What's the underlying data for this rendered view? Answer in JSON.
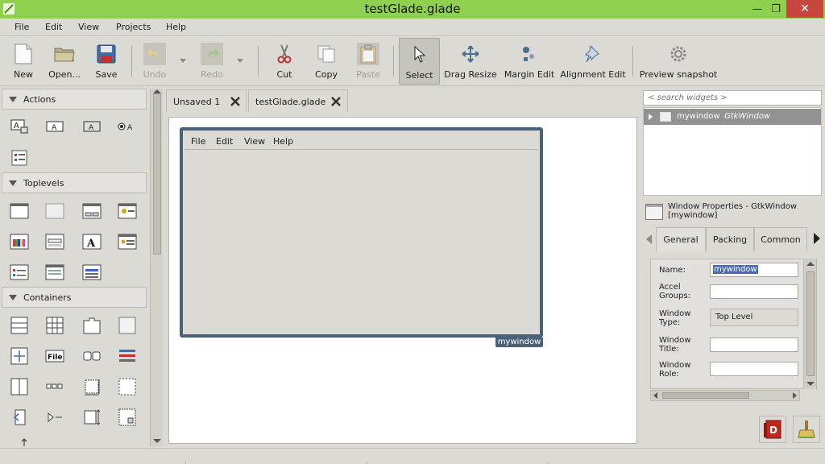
{
  "window": {
    "title": "testGlade.glade",
    "colors": {
      "titlebar": "#8fd14f",
      "close": "#c7463f",
      "selection": "#4a6279"
    }
  },
  "menubar": {
    "items": [
      "File",
      "Edit",
      "View",
      "Projects",
      "Help"
    ]
  },
  "toolbar": {
    "new": "New",
    "open": "Open...",
    "save": "Save",
    "undo": "Undo",
    "redo": "Redo",
    "cut": "Cut",
    "copy": "Copy",
    "paste": "Paste",
    "select": "Select",
    "drag_resize": "Drag Resize",
    "margin_edit": "Margin Edit",
    "alignment_edit": "Alignment Edit",
    "preview": "Preview snapshot"
  },
  "palette": {
    "groups": [
      "Actions",
      "Toplevels",
      "Containers"
    ]
  },
  "tabs": [
    "Unsaved 1",
    "testGlade.glade"
  ],
  "design": {
    "window_menu": [
      "File",
      "Edit",
      "View",
      "Help"
    ],
    "window_label": "mywindow"
  },
  "inspector": {
    "search_placeholder": "< search widgets >",
    "tree_row": {
      "name": "mywindow",
      "class": "GtkWindow"
    }
  },
  "properties": {
    "header_line1": "Window Properties - GtkWindow",
    "header_line2": "[mywindow]",
    "tabs": [
      "General",
      "Packing",
      "Common"
    ],
    "fields": {
      "name_label": "Name:",
      "name_value": "mywindow",
      "accel_label_1": "Accel",
      "accel_label_2": "Groups:",
      "type_label_1": "Window",
      "type_label_2": "Type:",
      "type_value": "Top Level",
      "title_label_1": "Window",
      "title_label_2": "Title:",
      "role_label_1": "Window",
      "role_label_2": "Role:"
    }
  }
}
